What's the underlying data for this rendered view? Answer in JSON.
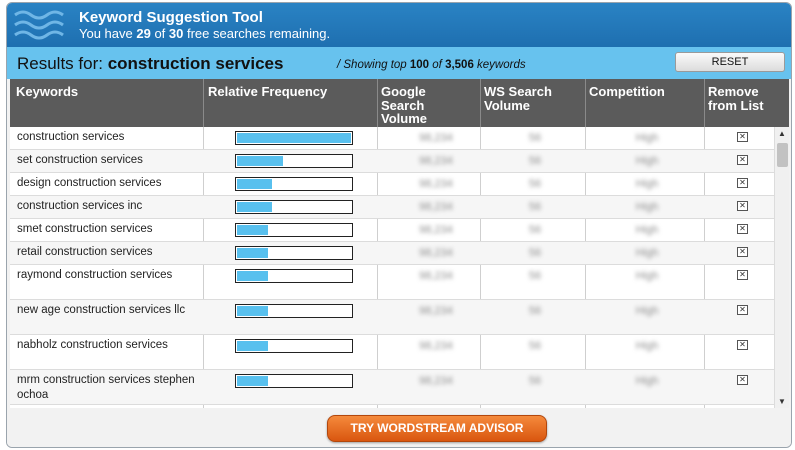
{
  "header": {
    "title": "Keyword Suggestion Tool",
    "subtitle_prefix": "You have ",
    "used": "29",
    "subtitle_mid": " of ",
    "total": "30",
    "subtitle_suffix": " free searches remaining."
  },
  "results": {
    "label": "Results for: ",
    "query": "construction services",
    "meta_prefix": " / Showing top ",
    "top": "100",
    "meta_mid": " of ",
    "count": "3,506",
    "meta_suffix": " keywords",
    "reset_label": "RESET"
  },
  "columns": {
    "keywords": "Keywords",
    "freq": "Relative Frequency",
    "google": "Google Search Volume",
    "ws": "WS Search Volume",
    "competition": "Competition",
    "remove": "Remove from List"
  },
  "rows": [
    {
      "keyword": "construction services",
      "frequency": 1.0,
      "google": "98,234",
      "ws": "56",
      "competition": "High"
    },
    {
      "keyword": "set construction services",
      "frequency": 0.4,
      "google": "98,234",
      "ws": "56",
      "competition": "High"
    },
    {
      "keyword": "design construction services",
      "frequency": 0.31,
      "google": "98,234",
      "ws": "56",
      "competition": "High"
    },
    {
      "keyword": "construction services inc",
      "frequency": 0.31,
      "google": "98,234",
      "ws": "56",
      "competition": "High"
    },
    {
      "keyword": "smet construction services",
      "frequency": 0.27,
      "google": "98,234",
      "ws": "56",
      "competition": "High"
    },
    {
      "keyword": "retail construction services",
      "frequency": 0.27,
      "google": "98,234",
      "ws": "56",
      "competition": "High"
    },
    {
      "keyword": "raymond construction services",
      "frequency": 0.27,
      "google": "98,234",
      "ws": "56",
      "competition": "High"
    },
    {
      "keyword": "new age construction services llc",
      "frequency": 0.27,
      "google": "98,234",
      "ws": "56",
      "competition": "High"
    },
    {
      "keyword": "nabholz construction services",
      "frequency": 0.27,
      "google": "98,234",
      "ws": "56",
      "competition": "High"
    },
    {
      "keyword": "mrm construction services stephen ochoa",
      "frequency": 0.27,
      "google": "98,234",
      "ws": "56",
      "competition": "High"
    }
  ],
  "remove_glyph": "✕",
  "footer": {
    "advisor_label": "TRY WORDSTREAM ADVISOR"
  },
  "colors": {
    "header": "#1e6fb0",
    "results_bar": "#67c2ee",
    "bar_fill": "#58c0ee",
    "table_header": "#5b5b5b",
    "advisor": "#e8691f"
  }
}
